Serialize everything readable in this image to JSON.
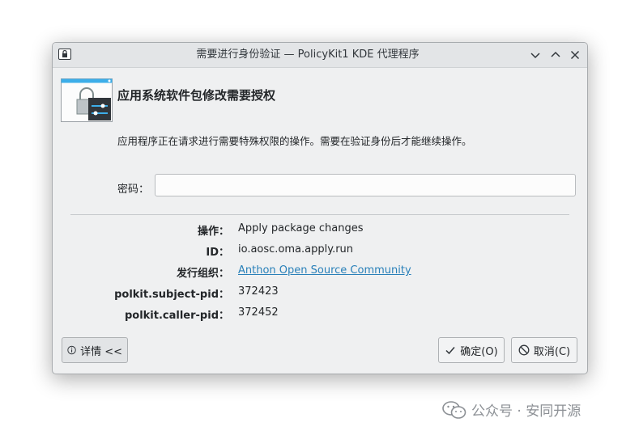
{
  "window": {
    "title": "需要进行身份验证 — PolicyKit1 KDE 代理程序",
    "controls": [
      "minimize-icon",
      "maximize-icon",
      "close-icon"
    ]
  },
  "header": {
    "heading": "应用系统软件包修改需要授权",
    "description": "应用程序正在请求进行需要特殊权限的操作。需要在验证身份后才能继续操作。"
  },
  "password": {
    "label": "密码：",
    "value": "",
    "placeholder": ""
  },
  "details": [
    {
      "key": "操作：",
      "value": "Apply package changes",
      "link": false
    },
    {
      "key": "ID：",
      "value": "io.aosc.oma.apply.run",
      "link": false
    },
    {
      "key": "发行组织：",
      "value": "Anthon Open Source Community",
      "link": true
    },
    {
      "key": "polkit.subject-pid：",
      "value": "372423",
      "link": false
    },
    {
      "key": "polkit.caller-pid：",
      "value": "372452",
      "link": false
    }
  ],
  "buttons": {
    "details": "详情 <<",
    "ok": "确定(O)",
    "cancel": "取消(C)"
  },
  "watermark": {
    "text": "公众号 · 安同开源"
  },
  "colors": {
    "window_bg": "#eff0f1",
    "link": "#2980b9",
    "accent": "#3daee9"
  }
}
